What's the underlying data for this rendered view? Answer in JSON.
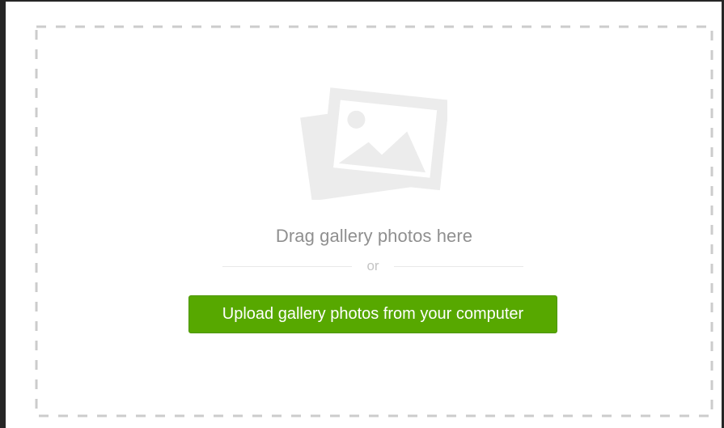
{
  "dropzone": {
    "icon": "photo-gallery-icon",
    "drag_text": "Drag gallery photos here",
    "or_text": "or",
    "upload_label": "Upload gallery photos from your computer"
  },
  "colors": {
    "button": "#57a800",
    "dash": "#cccccc",
    "icon": "#ececec"
  }
}
